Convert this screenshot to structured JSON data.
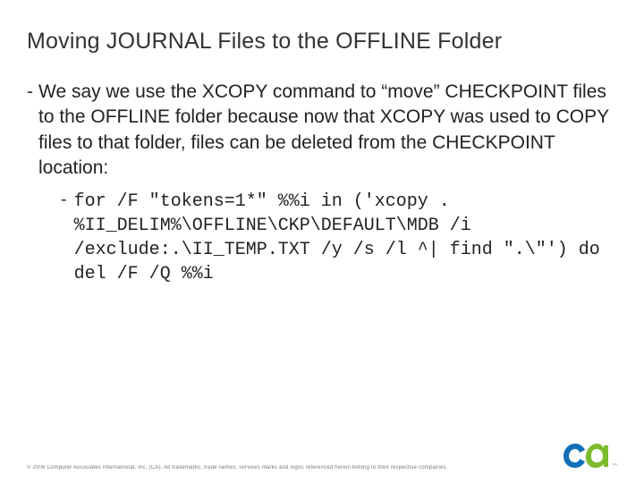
{
  "title": "Moving JOURNAL Files to the OFFLINE Folder",
  "bullet1": {
    "dash": "-",
    "text": "We say we use the XCOPY command to “move” CHECKPOINT files to the OFFLINE folder because now that XCOPY was used to COPY files to that folder, files can be deleted from the CHECKPOINT location:"
  },
  "bullet2": {
    "dash": "-",
    "code": "for /F \"tokens=1*\" %%i in ('xcopy . %II_DELIM%\\OFFLINE\\CKP\\DEFAULT\\MDB /i /exclude:.\\II_TEMP.TXT /y /s /l ^| find \".\\\"') do del /F /Q %%i"
  },
  "footer": {
    "copyright": "© 2006 Computer Associates International, Inc. (CA). All trademarks, trade names, services marks and logos referenced herein belong to their respective companies.",
    "tm": "™"
  },
  "logo": {
    "name": "ca-logo",
    "accent_blue": "#0f6fb7",
    "accent_green": "#7cbb2e"
  }
}
